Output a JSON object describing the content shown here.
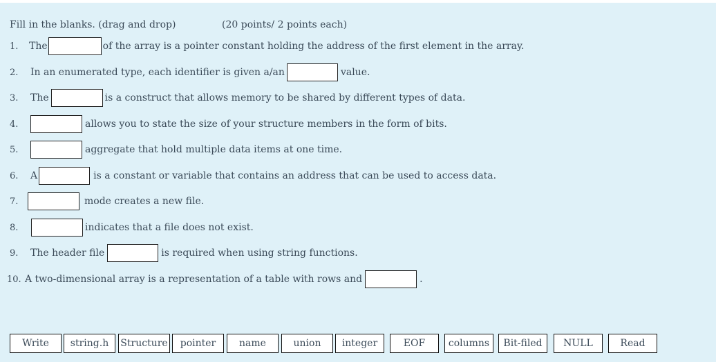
{
  "header": {
    "instructions": "Fill in the blanks. (drag and drop)",
    "points": "(20 points/ 2 points each)"
  },
  "questions": [
    {
      "num": "1.",
      "before": "The",
      "after": "of the array is a pointer constant holding the address of the first element in the array.",
      "blank_value": ""
    },
    {
      "num": "2.",
      "before": "In an enumerated type, each identifier is given a/an",
      "after": "value.",
      "blank_value": ""
    },
    {
      "num": "3.",
      "before": "The",
      "after": "is a construct that allows memory to be shared by different types of data.",
      "blank_value": ""
    },
    {
      "num": "4.",
      "before": "",
      "after": "allows you to state the size of your structure members in the form of bits.",
      "blank_value": ""
    },
    {
      "num": "5.",
      "before": "",
      "after": "aggregate that hold multiple data items at one time.",
      "blank_value": ""
    },
    {
      "num": "6.",
      "before": "A",
      "after": "is a constant or variable that contains an address that can be used to access data.",
      "blank_value": ""
    },
    {
      "num": "7.",
      "before": "",
      "after": "mode creates a new file.",
      "blank_value": ""
    },
    {
      "num": "8.",
      "before": "",
      "after": "indicates that a file does not exist.",
      "blank_value": ""
    },
    {
      "num": "9.",
      "before": "The header file",
      "after": "is required when using string functions.",
      "blank_value": ""
    },
    {
      "num": "10.",
      "before": "A two-dimensional array is a representation of a table with rows and",
      "after": ".",
      "blank_value": ""
    }
  ],
  "answer_tokens": [
    "Write",
    "string.h",
    "Structure",
    "pointer",
    "name",
    "union",
    "integer",
    "EOF",
    "columns",
    "Bit-filed",
    "NULL",
    "Read"
  ],
  "colors": {
    "background": "#dff1f8",
    "text": "#3b4a58",
    "blank": "#ffffff",
    "border": "#222222"
  }
}
